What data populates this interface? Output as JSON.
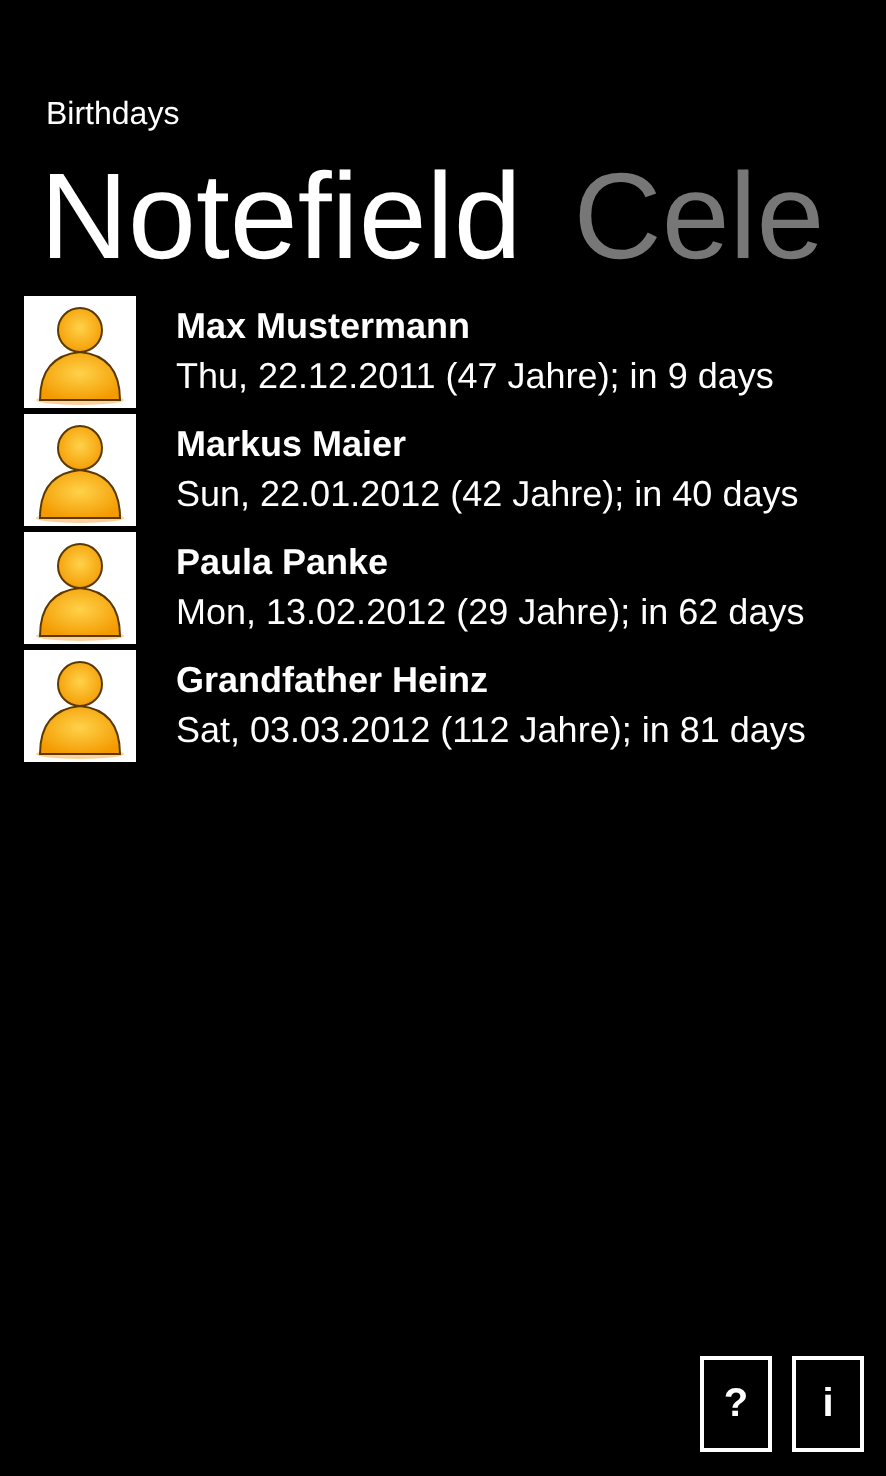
{
  "app": {
    "title": "Birthdays"
  },
  "pivots": [
    {
      "label": "Notefield",
      "selected": true
    },
    {
      "label": "Cele",
      "selected": false
    }
  ],
  "birthdays": [
    {
      "name": "Max Mustermann",
      "detail": "Thu, 22.12.2011 (47 Jahre); in 9 days"
    },
    {
      "name": "Markus Maier",
      "detail": "Sun, 22.01.2012 (42 Jahre); in 40 days"
    },
    {
      "name": "Paula Panke",
      "detail": "Mon, 13.02.2012 (29 Jahre); in 62 days"
    },
    {
      "name": "Grandfather Heinz",
      "detail": "Sat, 03.03.2012 (112 Jahre); in 81 days"
    }
  ],
  "buttons": [
    {
      "label": "?"
    },
    {
      "label": "i"
    }
  ]
}
